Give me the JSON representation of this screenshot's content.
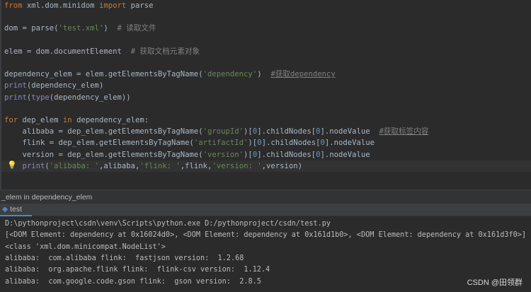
{
  "code_lines": [
    [
      [
        "kw",
        "from"
      ],
      [
        "p",
        " xml.dom.minidom "
      ],
      [
        "kw",
        "import"
      ],
      [
        "p",
        " parse"
      ]
    ],
    [],
    [
      [
        "p",
        "dom = parse("
      ],
      [
        "str",
        "'test.xml'"
      ],
      [
        "p",
        ")  "
      ],
      [
        "cm",
        "# 读取文件"
      ]
    ],
    [],
    [
      [
        "p",
        "elem = dom.documentElement  "
      ],
      [
        "cm",
        "# 获取文档元素对象"
      ]
    ],
    [],
    [
      [
        "p",
        "dependency_elem = elem.getElementsByTagName("
      ],
      [
        "str",
        "'dependency'"
      ],
      [
        "p",
        ")  "
      ],
      [
        "cmu",
        "#获取dependency"
      ]
    ],
    [
      [
        "bi",
        "print"
      ],
      [
        "p",
        "(dependency_elem)"
      ]
    ],
    [
      [
        "bi",
        "print"
      ],
      [
        "p",
        "("
      ],
      [
        "bi",
        "type"
      ],
      [
        "p",
        "(dependency_elem))"
      ]
    ],
    [],
    [
      [
        "kw",
        "for"
      ],
      [
        "p",
        " dep_elem "
      ],
      [
        "kw",
        "in"
      ],
      [
        "p",
        " dependency_elem:"
      ]
    ],
    [
      [
        "p",
        "    alibaba = dep_elem.getElementsByTagName("
      ],
      [
        "str",
        "'groupId'"
      ],
      [
        "p",
        ")["
      ],
      [
        "num",
        "0"
      ],
      [
        "p",
        "].childNodes["
      ],
      [
        "num",
        "0"
      ],
      [
        "p",
        "].nodeValue  "
      ],
      [
        "cmu",
        "#获取标签内容"
      ]
    ],
    [
      [
        "p",
        "    flink = dep_elem.getElementsByTagName("
      ],
      [
        "str",
        "'artifactId'"
      ],
      [
        "p",
        ")["
      ],
      [
        "num",
        "0"
      ],
      [
        "p",
        "].childNodes["
      ],
      [
        "num",
        "0"
      ],
      [
        "p",
        "].nodeValue"
      ]
    ],
    [
      [
        "p",
        "    version = dep_elem.getElementsByTagName("
      ],
      [
        "str",
        "'version'"
      ],
      [
        "p",
        ")["
      ],
      [
        "num",
        "0"
      ],
      [
        "p",
        "].childNodes["
      ],
      [
        "num",
        "0"
      ],
      [
        "p",
        "].nodeValue"
      ]
    ],
    [
      [
        "bi",
        "    print"
      ],
      [
        "p",
        "("
      ],
      [
        "str",
        "'alibaba: '"
      ],
      [
        "p",
        ",alibaba,"
      ],
      [
        "str",
        "'flink: '"
      ],
      [
        "p",
        ",flink,"
      ],
      [
        "str",
        "'version: '"
      ],
      [
        "p",
        ",version)"
      ]
    ]
  ],
  "breadcrumb": "_elem in dependency_elem",
  "run_tab": "test",
  "console_lines": [
    "D:\\pythonproject\\csdn\\venv\\Scripts\\python.exe D:/pythonproject/csdn/test.py",
    "[<DOM Element: dependency at 0x16024d0>, <DOM Element: dependency at 0x161d1b0>, <DOM Element: dependency at 0x161d3f0>]",
    "<class 'xml.dom.minicompat.NodeList'>",
    "alibaba:  com.alibaba flink:  fastjson version:  1.2.68",
    "alibaba:  org.apache.flink flink:  flink-csv version:  1.12.4",
    "alibaba:  com.google.code.gson flink:  gson version:  2.8.5"
  ],
  "watermark": "CSDN @田领群"
}
